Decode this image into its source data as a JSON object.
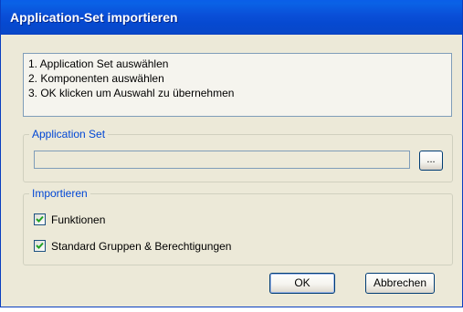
{
  "window": {
    "title": "Application-Set importieren"
  },
  "instructions": {
    "lines": [
      "1. Application Set auswählen",
      "2. Komponenten auswählen",
      "3. OK klicken um Auswahl zu übernehmen"
    ]
  },
  "application_set": {
    "legend": "Application Set",
    "path_value": "",
    "browse_label": "..."
  },
  "import": {
    "legend": "Importieren",
    "options": [
      {
        "label": "Funktionen",
        "checked": true
      },
      {
        "label": "Standard Gruppen & Berechtigungen",
        "checked": true
      }
    ]
  },
  "buttons": {
    "ok_label": "OK",
    "cancel_label": "Abbrechen"
  },
  "colors": {
    "titlebar": "#0a4fd8",
    "dialog_bg": "#ece9d8",
    "legend_text": "#0046d5",
    "button_border": "#003c74"
  }
}
